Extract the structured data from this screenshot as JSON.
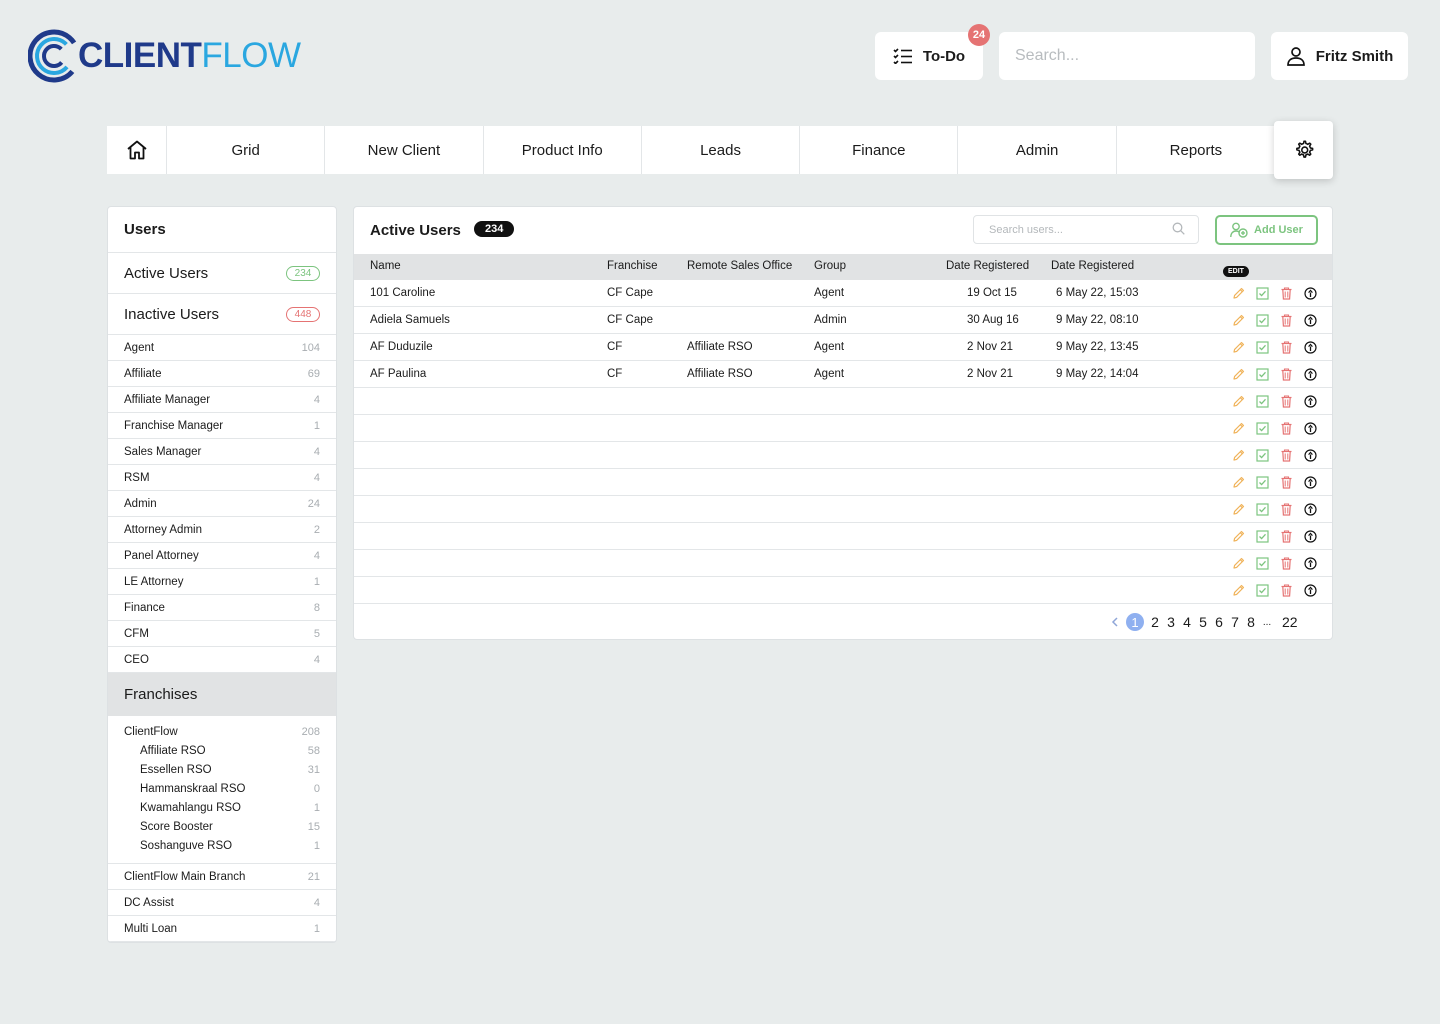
{
  "header": {
    "logo_bold": "CLIENT",
    "logo_light": "FLOW",
    "todo_label": "To-Do",
    "todo_badge": "24",
    "search_placeholder": "Search...",
    "user_name": "Fritz Smith"
  },
  "nav": {
    "items": [
      "Grid",
      "New Client",
      "Product Info",
      "Leads",
      "Finance",
      "Admin",
      "Reports"
    ]
  },
  "sidebar": {
    "users_title": "Users",
    "active_label": "Active Users",
    "active_count": "234",
    "inactive_label": "Inactive Users",
    "inactive_count": "448",
    "roles": [
      {
        "label": "Agent",
        "count": "104"
      },
      {
        "label": "Affiliate",
        "count": "69"
      },
      {
        "label": "Affiliate Manager",
        "count": "4"
      },
      {
        "label": "Franchise Manager",
        "count": "1"
      },
      {
        "label": "Sales Manager",
        "count": "4"
      },
      {
        "label": "RSM",
        "count": "4"
      },
      {
        "label": "Admin",
        "count": "24"
      },
      {
        "label": "Attorney Admin",
        "count": "2"
      },
      {
        "label": "Panel Attorney",
        "count": "4"
      },
      {
        "label": "LE Attorney",
        "count": "1"
      },
      {
        "label": "Finance",
        "count": "8"
      },
      {
        "label": "CFM",
        "count": "5"
      },
      {
        "label": "CEO",
        "count": "4"
      }
    ],
    "franchises_title": "Franchises",
    "franchise_parent": {
      "label": "ClientFlow",
      "count": "208"
    },
    "franchise_children": [
      {
        "label": "Affiliate RSO",
        "count": "58"
      },
      {
        "label": "Essellen RSO",
        "count": "31"
      },
      {
        "label": "Hammanskraal RSO",
        "count": "0"
      },
      {
        "label": "Kwamahlangu RSO",
        "count": "1"
      },
      {
        "label": "Score Booster",
        "count": "15"
      },
      {
        "label": "Soshanguve RSO",
        "count": "1"
      }
    ],
    "franchise_others": [
      {
        "label": "ClientFlow Main Branch",
        "count": "21"
      },
      {
        "label": "DC Assist",
        "count": "4"
      },
      {
        "label": "Multi Loan",
        "count": "1"
      }
    ]
  },
  "main": {
    "title": "Active Users",
    "count": "234",
    "search_placeholder": "Search users...",
    "add_user_label": "Add User",
    "edit_tooltip": "EDIT",
    "columns": [
      "Name",
      "Franchise",
      "Remote Sales Office",
      "Group",
      "Date Registered",
      "Date Registered"
    ],
    "rows": [
      [
        "101 Caroline",
        "CF Cape",
        "",
        "Agent",
        "19 Oct 15",
        "6 May 22, 15:03"
      ],
      [
        "Adiela Samuels",
        "CF Cape",
        "",
        "Admin",
        "30 Aug 16",
        "9 May 22, 08:10"
      ],
      [
        "AF Duduzile",
        "CF",
        "Affiliate RSO",
        "Agent",
        "2 Nov 21",
        "9 May 22, 13:45"
      ],
      [
        "AF Paulina",
        "CF",
        "Affiliate RSO",
        "Agent",
        "2 Nov 21",
        "9 May 22, 14:04"
      ],
      [
        "",
        "",
        "",
        "",
        "",
        ""
      ],
      [
        "",
        "",
        "",
        "",
        "",
        ""
      ],
      [
        "",
        "",
        "",
        "",
        "",
        ""
      ],
      [
        "",
        "",
        "",
        "",
        "",
        ""
      ],
      [
        "",
        "",
        "",
        "",
        "",
        ""
      ],
      [
        "",
        "",
        "",
        "",
        "",
        ""
      ],
      [
        "",
        "",
        "",
        "",
        "",
        ""
      ],
      [
        "",
        "",
        "",
        "",
        "",
        ""
      ]
    ],
    "pagination": {
      "active": "1",
      "pages": [
        "2",
        "3",
        "4",
        "5",
        "6",
        "7",
        "8"
      ],
      "ellipsis": "...",
      "last": "22"
    }
  },
  "colors": {
    "background": "#e8ecec",
    "green": "#7cc47f",
    "red": "#e57373",
    "edit_orange": "#f0b35a",
    "logo_dark": "#1f3a8a",
    "logo_light": "#2aa7e0"
  }
}
